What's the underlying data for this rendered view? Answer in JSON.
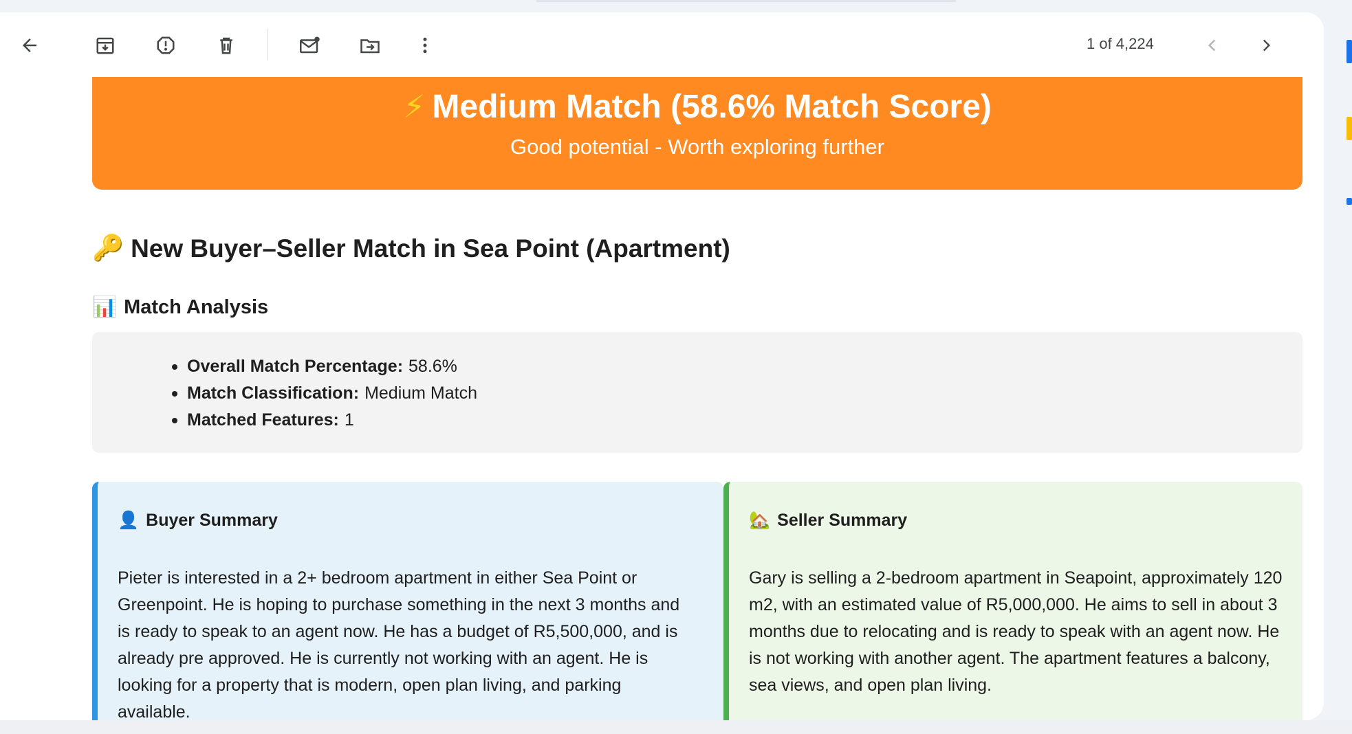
{
  "toolbar": {
    "back": "back-arrow-icon",
    "archive": "archive-icon",
    "spam": "report-spam-icon",
    "delete": "delete-icon",
    "mark_unread": "mark-unread-icon",
    "move": "move-to-icon",
    "more": "more-vert-icon",
    "pager_text": "1 of 4,224"
  },
  "banner": {
    "icon": "⚡",
    "title": "Medium Match (58.6% Match Score)",
    "subtitle": "Good potential - Worth exploring further",
    "color": "#ff8a22"
  },
  "email": {
    "heading_icon": "🔑",
    "heading": "New Buyer–Seller Match in Sea Point (Apartment)",
    "analysis_icon": "📊",
    "analysis_title": "Match Analysis",
    "analysis_items": [
      {
        "label": "Overall Match Percentage:",
        "value": "58.6%"
      },
      {
        "label": "Match Classification:",
        "value": "Medium Match"
      },
      {
        "label": "Matched Features:",
        "value": "1"
      }
    ]
  },
  "buyer": {
    "icon": "👤",
    "title": "Buyer Summary",
    "text": "Pieter is interested in a 2+ bedroom apartment in either Sea Point or Greenpoint. He is hoping to purchase something in the next 3 months and is ready to speak to an agent now. He has a budget of R5,500,000, and is already pre approved. He is currently not working with an agent. He is looking for a property that is modern, open plan living, and parking available.",
    "accent": "#2d95e4"
  },
  "seller": {
    "icon": "🏡",
    "title": "Seller Summary",
    "text": "Gary is selling a 2-bedroom apartment in Seapoint, approximately 120 m2, with an estimated value of R5,000,000. He aims to sell in about 3 months due to relocating and is ready to speak with an agent now. He is not working with another agent. The apartment features a balcony, sea views, and open plan living.",
    "accent": "#4caf50"
  }
}
